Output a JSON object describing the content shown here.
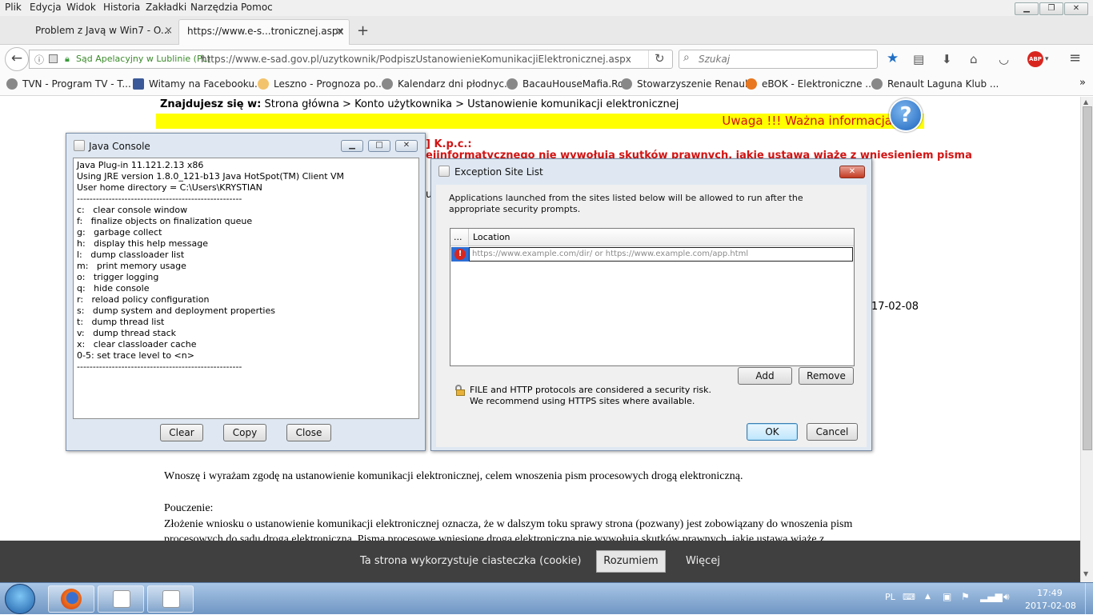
{
  "menu": [
    "Plik",
    "Edycja",
    "Widok",
    "Historia",
    "Zakładki",
    "Narzędzia",
    "Pomoc"
  ],
  "tabs": [
    {
      "label": "Problem z Javą w Win7 - O..."
    },
    {
      "label": "https://www.e-s...tronicznej.aspx"
    }
  ],
  "tab_close": "×",
  "new_tab": "+",
  "navbar": {
    "site_identity": "Sąd Apelacyjny w Lublinie (PL)",
    "url": "https://www.e-sad.gov.pl/uzytkownik/PodpiszUstanowienieKomunikacjiElektronicznej.aspx",
    "search_placeholder": "Szukaj",
    "abp": "ABP"
  },
  "bookmarks": [
    "TVN - Program TV - T...",
    "Witamy na Facebooku...",
    "Leszno - Prognoza po...",
    "Kalendarz dni płodnyc...",
    "BacauHouseMafia.Ro",
    "Stowarzyszenie Renaul...",
    "eBOK - Elektroniczne ...",
    "Renault Laguna Klub ..."
  ],
  "bookmarks_more": "»",
  "page": {
    "breadcrumb_label": "Znajdujesz się w:",
    "breadcrumb": "Strona główna > Konto użytkownika > Ustanowienie komunikacji elektronicznej",
    "warning": "Uwaga !!! Ważna informacja",
    "help": "?",
    "red_line1": "] K.p.c.:",
    "red_line2": "ejinformatycznego nie wywołują skutków prawnych, jakie ustawa wiąże z wniesieniem pisma",
    "frag_u": "u",
    "date_frag": "17-02-08",
    "consent": "Wnoszę i wyrażam zgodę na ustanowienie komunikacji elektronicznej, celem wnoszenia pism procesowych drogą elektroniczną.",
    "pouczenie": "Pouczenie:",
    "body1": "Złożenie wniosku o ustanowienie komunikacji elektronicznej oznacza, że w dalszym toku sprawy strona (pozwany) jest zobowiązany do wnoszenia pism",
    "body2": "procesowych do sądu drogą elektroniczną. Pisma procesowe wniesione drogą elektroniczną nie wywołują skutków prawnych, jakie ustawa wiąże z"
  },
  "java_console": {
    "title": "Java Console",
    "text": "Java Plug-in 11.121.2.13 x86\nUsing JRE version 1.8.0_121-b13 Java HotSpot(TM) Client VM\nUser home directory = C:\\Users\\KRYSTIAN\n----------------------------------------------------\nc:   clear console window\nf:   finalize objects on finalization queue\ng:   garbage collect\nh:   display this help message\nl:   dump classloader list\nm:   print memory usage\no:   trigger logging\nq:   hide console\nr:   reload policy configuration\ns:   dump system and deployment properties\nt:   dump thread list\nv:   dump thread stack\nx:   clear classloader cache\n0-5: set trace level to <n>\n----------------------------------------------------",
    "clear": "Clear",
    "copy": "Copy",
    "close": "Close"
  },
  "exception_list": {
    "title": "Exception Site List",
    "description": "Applications launched from the sites listed below will be allowed to run after the appropriate security prompts.",
    "col_dots": "...",
    "col_location": "Location",
    "placeholder": "https://www.example.com/dir/ or https://www.example.com/app.html",
    "add": "Add",
    "remove": "Remove",
    "warning1": "FILE and HTTP protocols are considered a security risk.",
    "warning2": "We recommend using HTTPS sites where available.",
    "ok": "OK",
    "cancel": "Cancel",
    "close": "✕"
  },
  "cookie": {
    "text": "Ta strona wykorzystuje ciasteczka (cookie)",
    "accept": "Rozumiem",
    "more": "Więcej"
  },
  "tray": {
    "lang": "PL",
    "time": "17:49",
    "date": "2017-02-08"
  },
  "colors": {
    "warning_yellow": "#ffff00",
    "warning_red": "#d21414",
    "cookie_bg": "#404040"
  }
}
